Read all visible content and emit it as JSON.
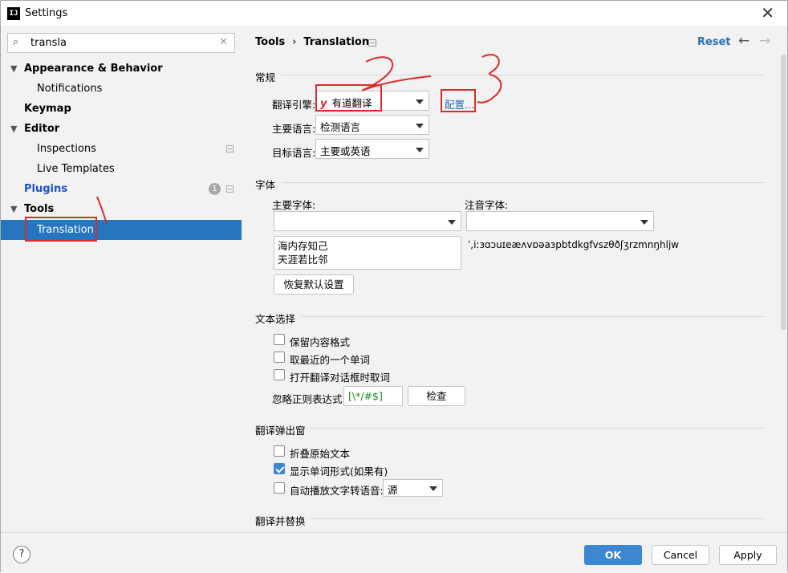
{
  "window": {
    "title": "Settings",
    "app_icon": "IJ"
  },
  "search": {
    "value": "transla"
  },
  "sidebar": {
    "items": [
      {
        "label": "Appearance & Behavior"
      },
      {
        "label": "Notifications"
      },
      {
        "label": "Keymap"
      },
      {
        "label": "Editor"
      },
      {
        "label": "Inspections"
      },
      {
        "label": "Live Templates"
      },
      {
        "label": "Plugins",
        "badge": "1"
      },
      {
        "label": "Tools"
      },
      {
        "label": "Translation"
      }
    ]
  },
  "header": {
    "crumb1": "Tools",
    "crumb_sep": "›",
    "crumb2": "Translation",
    "reset": "Reset"
  },
  "general": {
    "title": "常规",
    "engine_label": "翻译引擎:",
    "engine_value": "有道翻译",
    "engine_logo": "y",
    "config_link": "配置...",
    "primary_lang_label": "主要语言:",
    "primary_lang_value": "检测语言",
    "target_lang_label": "目标语言:",
    "target_lang_value": "主要或英语"
  },
  "font": {
    "title": "字体",
    "primary_font_label": "主要字体:",
    "phonetic_font_label": "注音字体:",
    "preview_line1": "海内存知己",
    "preview_line2": "天涯若比邻",
    "phonetic_preview": "ˈ,iːɜɑɔuɪeæʌvɒəaɜpbtdkgfvszθðʃʒrzmnŋhljw",
    "restore_button": "恢复默认设置"
  },
  "text_selection": {
    "title": "文本选择",
    "keep_format": "保留内容格式",
    "nearest_word": "取最近的一个单词",
    "take_on_open": "打开翻译对话框时取词",
    "ignore_regex_label": "忽略正则表达式:",
    "ignore_regex_value": "[\\*/#$]",
    "check_button": "检查"
  },
  "popup": {
    "title": "翻译弹出窗",
    "fold_original": "折叠原始文本",
    "show_word_forms": "显示单词形式(如果有)",
    "auto_tts": "自动播放文字转语音:",
    "tts_value": "源"
  },
  "translate_replace": {
    "title": "翻译并替换"
  },
  "footer": {
    "ok": "OK",
    "cancel": "Cancel",
    "apply": "Apply",
    "help": "?"
  },
  "colors": {
    "accent": "#2675bf",
    "link": "#2470b3",
    "annotation": "#e02a2a"
  }
}
